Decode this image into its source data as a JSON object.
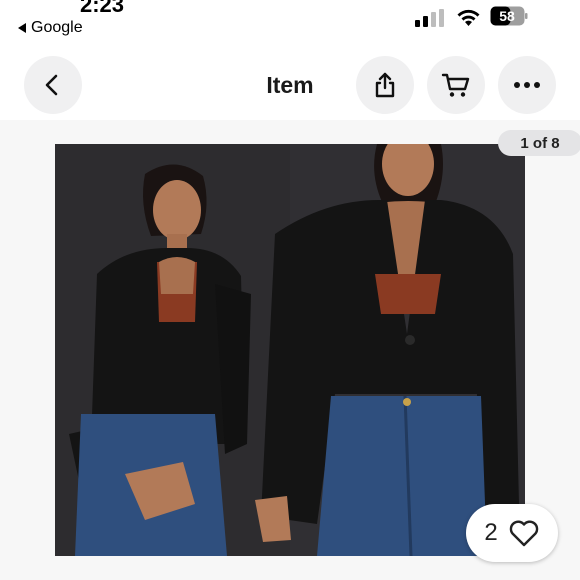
{
  "status_bar": {
    "time": "2:23",
    "back_app_label": "Google",
    "battery_level": "58"
  },
  "header": {
    "title": "Item",
    "icons": [
      "chevron-left-icon",
      "share-icon",
      "cart-icon",
      "more-icon"
    ]
  },
  "gallery": {
    "counter": "1 of 8",
    "like_count": "2"
  },
  "colors": {
    "button_bg": "#f0f0f1",
    "photo_bg": "#2d2c2f",
    "jacket": "#141414",
    "top": "#8a3a22",
    "jeans": "#2f4f7e"
  }
}
